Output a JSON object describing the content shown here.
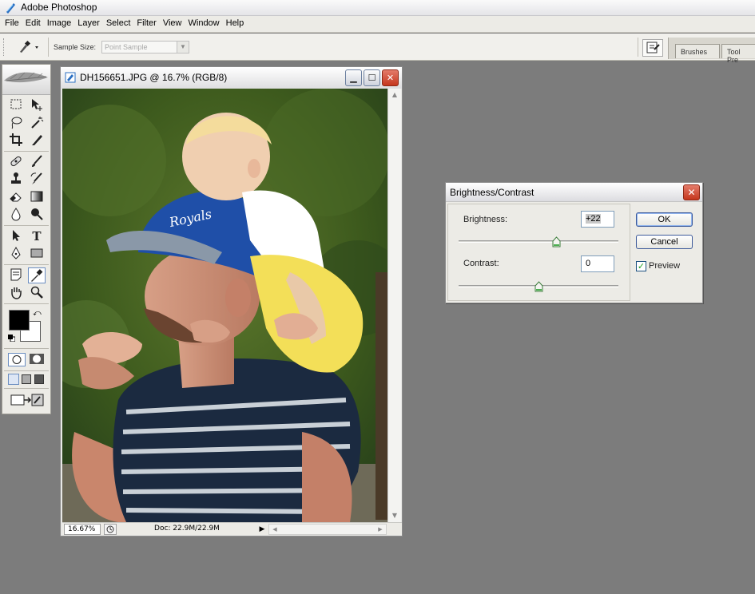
{
  "app": {
    "title": "Adobe Photoshop"
  },
  "menu": [
    "File",
    "Edit",
    "Image",
    "Layer",
    "Select",
    "Filter",
    "View",
    "Window",
    "Help"
  ],
  "options": {
    "sample_size_label": "Sample Size:",
    "sample_size_value": "Point Sample",
    "palette_tabs": [
      "Brushes",
      "Tool Pre"
    ]
  },
  "document": {
    "title": "DH156651.JPG @ 16.7% (RGB/8)",
    "zoom": "16.67%",
    "doc_size": "Doc: 22.9M/22.9M"
  },
  "dialog": {
    "title": "Brightness/Contrast",
    "brightness_label": "Brightness:",
    "brightness_value": "+22",
    "brightness_level": 0.61,
    "contrast_label": "Contrast:",
    "contrast_value": "0",
    "contrast_level": 0.5,
    "ok_label": "OK",
    "cancel_label": "Cancel",
    "preview_label": "Preview",
    "preview_checked": true
  },
  "colors": {
    "foreground": "#000000",
    "background": "#ffffff",
    "workspace": "#7c7c7c",
    "close_button": "#c5361d"
  }
}
